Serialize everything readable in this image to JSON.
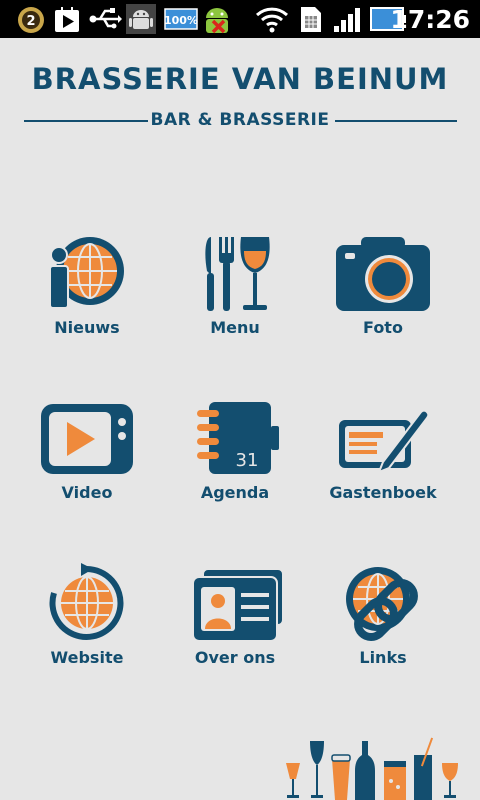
{
  "status_bar": {
    "notification_count": "2",
    "battery_text": "100%",
    "time": "17:26",
    "icons": [
      "notification-badge-icon",
      "play-store-icon",
      "usb-icon",
      "android-debug-icon",
      "battery-icon",
      "android-warning-icon",
      "wifi-icon",
      "sim-icon",
      "signal-icon",
      "battery-level-icon"
    ]
  },
  "header": {
    "title": "BRASSERIE VAN BEINUM",
    "subtitle": "BAR & BRASSERIE"
  },
  "menu": {
    "items": [
      {
        "label": "Nieuws",
        "icon": "news-globe-icon"
      },
      {
        "label": "Menu",
        "icon": "cutlery-wine-icon"
      },
      {
        "label": "Foto",
        "icon": "camera-icon"
      },
      {
        "label": "Video",
        "icon": "video-player-icon"
      },
      {
        "label": "Agenda",
        "icon": "calendar-notebook-icon",
        "date": "31"
      },
      {
        "label": "Gastenboek",
        "icon": "guestbook-pen-icon"
      },
      {
        "label": "Website",
        "icon": "website-globe-icon"
      },
      {
        "label": "Over ons",
        "icon": "id-card-icon"
      },
      {
        "label": "Links",
        "icon": "globe-link-icon"
      }
    ]
  },
  "colors": {
    "primary": "#134e6f",
    "accent": "#ef8a3c",
    "background": "#e6e6e6"
  }
}
